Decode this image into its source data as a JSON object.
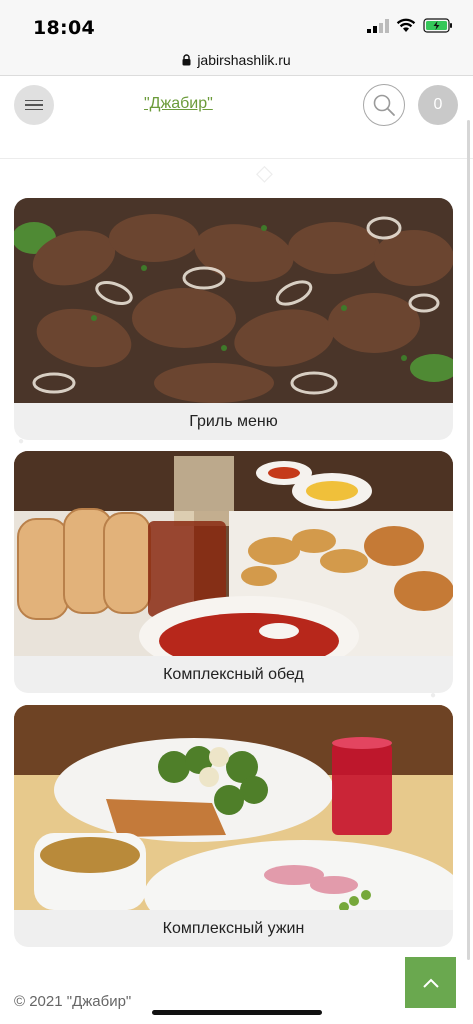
{
  "status_bar": {
    "time": "18:04",
    "icons": [
      "cellular-signal-icon",
      "wifi-icon",
      "battery-charging-icon"
    ]
  },
  "browser": {
    "url": "jabirshashlik.ru",
    "lock_icon": "lock-icon"
  },
  "header": {
    "menu_icon": "hamburger-menu-icon",
    "brand": "\"Джабир\"",
    "search_icon": "search-icon",
    "cart_count": "0"
  },
  "categories": [
    {
      "label": "Гриль меню"
    },
    {
      "label": "Комплексный обед"
    },
    {
      "label": "Комплексный ужин"
    }
  ],
  "footer": {
    "copyright": "© 2021 \"Джабир\"",
    "scroll_top_icon": "chevron-up-icon"
  },
  "colors": {
    "accent_green": "#6aa84f",
    "brand_link": "#6b9b3a",
    "card_bg": "#efefef"
  }
}
